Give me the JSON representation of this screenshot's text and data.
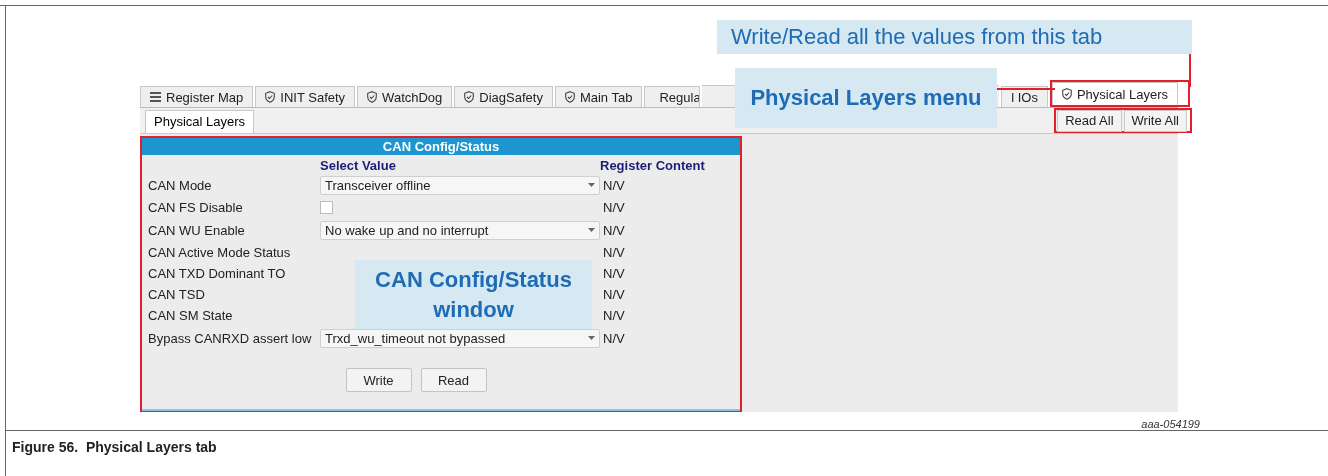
{
  "tabs": [
    {
      "label": "Register Map",
      "selected": false
    },
    {
      "label": "INIT Safety",
      "selected": false
    },
    {
      "label": "WatchDog",
      "selected": false
    },
    {
      "label": "DiagSafety",
      "selected": false
    },
    {
      "label": "Main Tab",
      "selected": false
    },
    {
      "label": "Regula",
      "selected": false
    },
    {
      "label": "l IOs",
      "selected": false
    },
    {
      "label": "Physical Layers",
      "selected": true
    }
  ],
  "subtabs": [
    {
      "label": "Physical Layers",
      "selected": true
    }
  ],
  "toolbar_buttons": [
    "Read All",
    "Write All"
  ],
  "panel": {
    "title": "CAN Config/Status",
    "columns": [
      "Select Value",
      "Register Content"
    ],
    "rows": [
      {
        "label": "CAN Mode",
        "kind": "dropdown",
        "value": "Transceiver offline",
        "content": "N/V"
      },
      {
        "label": "CAN FS Disable",
        "kind": "checkbox",
        "checked": false,
        "content": "N/V"
      },
      {
        "label": "CAN WU Enable",
        "kind": "dropdown",
        "value": "No wake up and no interrupt",
        "content": "N/V"
      },
      {
        "label": "CAN Active Mode Status",
        "kind": "status",
        "content": "N/V"
      },
      {
        "label": "CAN TXD Dominant TO",
        "kind": "status",
        "content": "N/V"
      },
      {
        "label": "CAN TSD",
        "kind": "status",
        "content": "N/V"
      },
      {
        "label": "CAN SM State",
        "kind": "status",
        "content": "N/V"
      },
      {
        "label": "Bypass CANRXD assert low",
        "kind": "dropdown",
        "value": "Trxd_wu_timeout  not bypassed",
        "content": "N/V"
      }
    ],
    "buttons": [
      "Write",
      "Read"
    ]
  },
  "callouts": [
    {
      "text": "Write/Read all the values from this tab"
    },
    {
      "text": "Physical Layers menu"
    },
    {
      "text": "CAN Config/Status window"
    }
  ],
  "figure_id": "aaa-054199",
  "caption": "Figure 56.  Physical Layers tab"
}
